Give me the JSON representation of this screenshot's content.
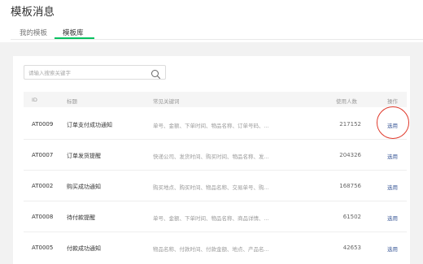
{
  "page": {
    "title": "模板消息"
  },
  "tabs": [
    {
      "label": "我的模板",
      "active": false
    },
    {
      "label": "模板库",
      "active": true
    }
  ],
  "search": {
    "placeholder": "请输入搜索关键字",
    "value": ""
  },
  "table": {
    "headers": {
      "id": "ID",
      "title": "标题",
      "keywords": "常见关键词",
      "count": "使用人数",
      "action": "操作"
    },
    "rows": [
      {
        "id": "AT0009",
        "title": "订单支付成功通知",
        "keywords": "单号、金额、下单时间、物品名称、订单号码、...",
        "count": "217152",
        "action": "选用"
      },
      {
        "id": "AT0007",
        "title": "订单发货提醒",
        "keywords": "快递公司、发货时间、购买时间、物品名称、发...",
        "count": "204326",
        "action": "选用"
      },
      {
        "id": "AT0002",
        "title": "购买成功通知",
        "keywords": "购买地点、购买时间、物品名称、交易单号、购...",
        "count": "168756",
        "action": "选用"
      },
      {
        "id": "AT0008",
        "title": "待付款提醒",
        "keywords": "单号、金额、下单时间、物品名称、商品详情、...",
        "count": "61502",
        "action": "选用"
      },
      {
        "id": "AT0005",
        "title": "付款成功通知",
        "keywords": "物品名称、付款时间、付款金额、地点、产品名...",
        "count": "42653",
        "action": "选用"
      }
    ]
  },
  "colors": {
    "accent": "#07c160",
    "link": "#3b5998",
    "highlight": "#e0392b"
  },
  "icons": {
    "search": "search-icon"
  }
}
